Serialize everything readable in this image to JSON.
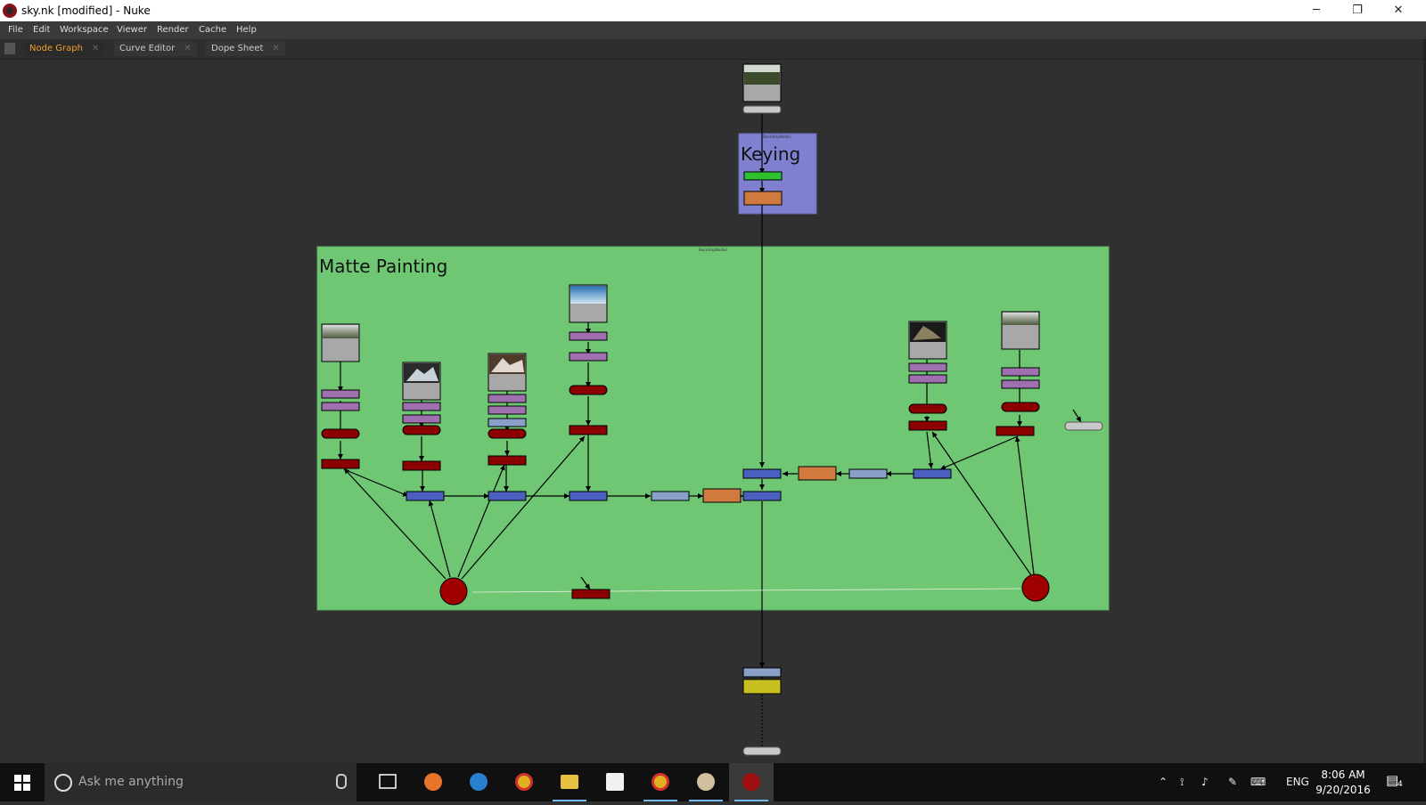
{
  "window": {
    "title": "sky.nk [modified] - Nuke",
    "controls": [
      "─",
      "❐",
      "✕"
    ]
  },
  "menu": [
    "File",
    "Edit",
    "Workspace",
    "Viewer",
    "Render",
    "Cache",
    "Help"
  ],
  "tabs": [
    {
      "label": "Node Graph",
      "active": true
    },
    {
      "label": "Curve Editor",
      "active": false
    },
    {
      "label": "Dope Sheet",
      "active": false
    }
  ],
  "tab_close_glyph": "✕",
  "backdrops": {
    "keying": {
      "label": "Keying",
      "small_label": "BackdropNode1",
      "color": "#7f80d0"
    },
    "matte": {
      "label": "Matte Painting",
      "small_label": "BackdropNode2",
      "color": "#6fc774"
    }
  },
  "colors": {
    "read_node": "#a0a0a0",
    "grade_node": "#a06fb0",
    "transform_node": "#8b0000",
    "merge_node": "#4a5fc0",
    "blur_node": "#8aa0c8",
    "orange_node": "#d07a40",
    "keyer_node": "#2ec02e",
    "yellow_node": "#c8c020",
    "wire": "#000000"
  },
  "taskbar": {
    "search_placeholder": "Ask me anything",
    "apps": [
      "task-view-icon",
      "firefox-icon",
      "edge-icon",
      "chrome-icon",
      "file-explorer-icon",
      "store-icon",
      "chrome-icon",
      "paint-icon",
      "nuke-icon"
    ],
    "language": "ENG",
    "time": "8:06 AM",
    "date": "9/20/2016",
    "notifications": "4"
  }
}
